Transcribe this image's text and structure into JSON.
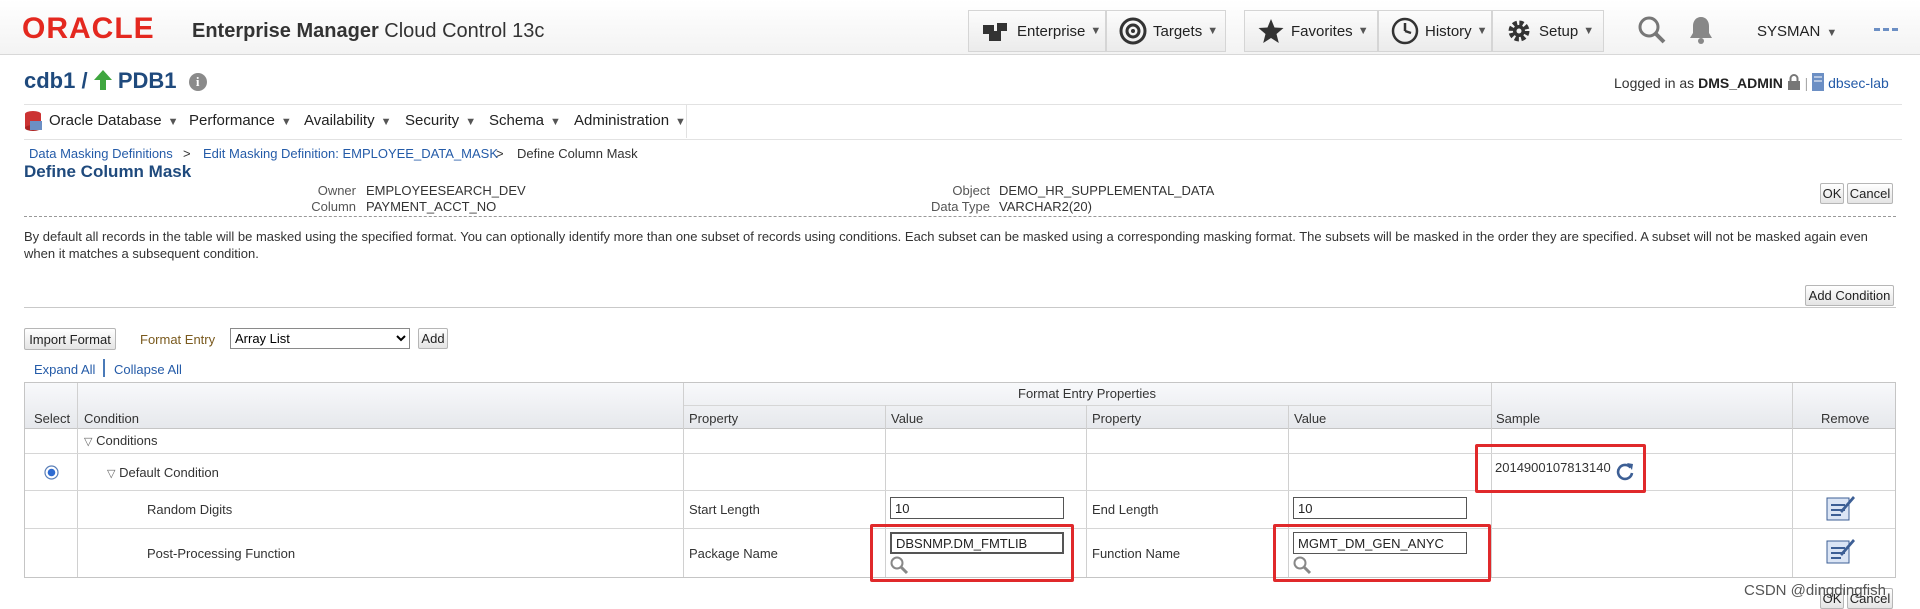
{
  "header": {
    "logo": "ORACLE",
    "product_bold": "Enterprise Manager",
    "product_rest": "Cloud Control 13c",
    "nav": [
      {
        "label": "Enterprise",
        "icon": "enterprise-icon"
      },
      {
        "label": "Targets",
        "icon": "targets-icon"
      },
      {
        "label": "Favorites",
        "icon": "star-icon"
      },
      {
        "label": "History",
        "icon": "clock-icon"
      },
      {
        "label": "Setup",
        "icon": "gear-icon"
      }
    ],
    "user": "SYSMAN"
  },
  "target": {
    "parent": "cdb1",
    "separator": "/",
    "name": "PDB1",
    "logged_in_label": "Logged in as",
    "logged_in_user": "DMS_ADMIN",
    "host": "dbsec-lab"
  },
  "menu": [
    "Oracle Database",
    "Performance",
    "Availability",
    "Security",
    "Schema",
    "Administration"
  ],
  "breadcrumb": [
    "Data Masking Definitions",
    ">",
    "Edit Masking Definition: EMPLOYEE_DATA_MASK",
    ">",
    "Define Column Mask"
  ],
  "page": {
    "title": "Define Column Mask",
    "owner_label": "Owner",
    "owner": "EMPLOYEESEARCH_DEV",
    "column_label": "Column",
    "column": "PAYMENT_ACCT_NO",
    "object_label": "Object",
    "object": "DEMO_HR_SUPPLEMENTAL_DATA",
    "datatype_label": "Data Type",
    "datatype": "VARCHAR2(20)",
    "ok": "OK",
    "cancel": "Cancel",
    "description": "By default all records in the table will be masked using the specified format. You can optionally identify more than one subset of records using conditions. Each subset can be masked using a corresponding masking format. The subsets will be masked in the order they are specified. A subset will not be masked again even when it matches a subsequent condition.",
    "add_condition": "Add Condition",
    "import_format": "Import Format",
    "format_entry_label": "Format Entry",
    "format_entry_value": "Array List",
    "add": "Add",
    "expand_all": "Expand All",
    "collapse_all": "Collapse All"
  },
  "table": {
    "group_header": "Format Entry Properties",
    "columns": [
      "Select",
      "Condition",
      "Property",
      "Value",
      "Property",
      "Value",
      "Sample",
      "Remove"
    ],
    "rows": {
      "conditions": "Conditions",
      "default_condition": "Default Condition",
      "sample": "2014900107813140",
      "random_digits": {
        "name": "Random Digits",
        "prop1": "Start Length",
        "val1": "10",
        "prop2": "End Length",
        "val2": "10"
      },
      "post_processing": {
        "name": "Post-Processing Function",
        "prop1": "Package Name",
        "val1": "DBSNMP.DM_FMTLIB",
        "prop2": "Function Name",
        "val2": "MGMT_DM_GEN_ANYC"
      }
    }
  },
  "watermark": "CSDN @dingdingfish",
  "colors": {
    "oracle_red": "#e4281f",
    "link_blue": "#245ba8",
    "title_blue": "#1f4a7d",
    "highlight_red": "#e0292b"
  }
}
